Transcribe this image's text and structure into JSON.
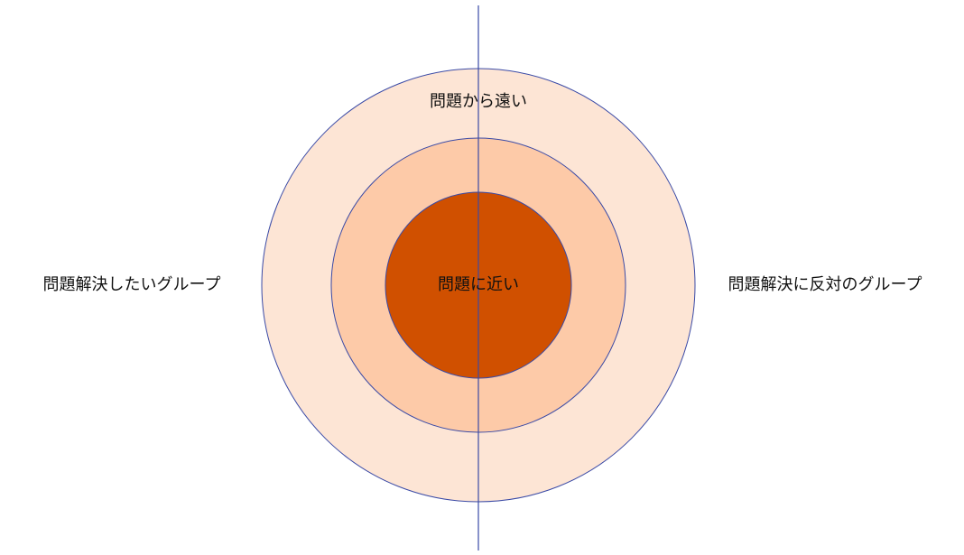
{
  "labels": {
    "far_from_problem": "問題から遠い",
    "close_to_problem": "問題に近い",
    "want_to_solve_group": "問題解決したいグループ",
    "oppose_solution_group": "問題解決に反対のグループ"
  },
  "colors": {
    "outer_ring": "#FDE5D5",
    "middle_ring": "#FDCAA8",
    "inner_circle": "#D05000",
    "outline": "#3A4AA6",
    "text": "#111111"
  }
}
